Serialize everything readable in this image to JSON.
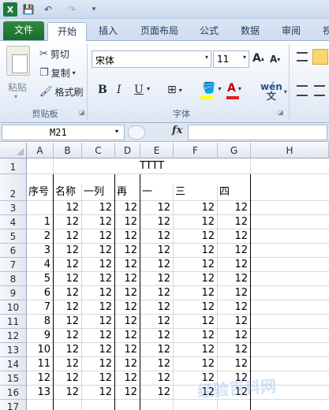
{
  "quick_access": {
    "logo": "X",
    "save": "💾",
    "undo": "↶",
    "redo": "↷",
    "more": "▾"
  },
  "tabs": {
    "file": "文件",
    "home": "开始",
    "insert": "插入",
    "layout": "页面布局",
    "formula": "公式",
    "data": "数据",
    "review": "审阅",
    "view": "视"
  },
  "ribbon": {
    "paste": "粘贴",
    "cut": "剪切",
    "copy": "复制",
    "painter": "格式刷",
    "clipboard_group": "剪贴板",
    "font_name": "宋体",
    "font_size": "11",
    "bold": "B",
    "italic": "I",
    "underline": "U",
    "grow": "A",
    "shrink": "A",
    "font_color_glyph": "A",
    "wen": "wén\n文",
    "font_group": "字体"
  },
  "formula_bar": {
    "name_box": "M21",
    "fx": "fx",
    "value": ""
  },
  "grid": {
    "columns": [
      "A",
      "B",
      "C",
      "D",
      "E",
      "F",
      "G",
      "H"
    ],
    "rows": [
      "1",
      "2",
      "3",
      "4",
      "5",
      "6",
      "7",
      "8",
      "9",
      "10",
      "11",
      "12",
      "13",
      "14",
      "15",
      "16",
      "17"
    ],
    "title": "TTTT",
    "headers": [
      "序号",
      "名称",
      "一列",
      "再",
      "一",
      "三",
      "四"
    ],
    "value": "12",
    "serials": [
      "1",
      "2",
      "3",
      "4",
      "5",
      "6",
      "7",
      "8",
      "9",
      "10",
      "11",
      "12",
      "13"
    ]
  },
  "watermark": "经验百科网"
}
